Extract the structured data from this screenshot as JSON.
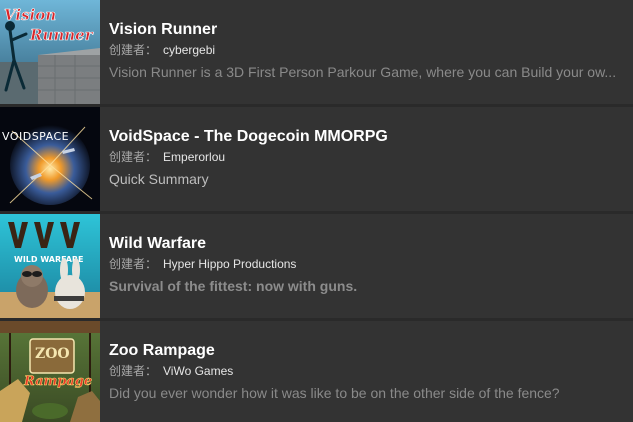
{
  "games": [
    {
      "title": "Vision Runner",
      "creator_label": "创建者：",
      "creator": "cybergebi",
      "description": "Vision Runner is a 3D First Person Parkour Game, where you can Build your ow...",
      "thumb_title": "Vision Runner"
    },
    {
      "title": "VoidSpace - The Dogecoin MMORPG",
      "creator_label": "创建者：",
      "creator": "Emperorlou",
      "description": "Quick Summary",
      "thumb_title": "VOIDSPACE"
    },
    {
      "title": "Wild Warfare",
      "creator_label": "创建者：",
      "creator": "Hyper Hippo Productions",
      "description": "Survival of the fittest: now with guns.",
      "thumb_title": "WILD WARFARE"
    },
    {
      "title": "Zoo Rampage",
      "creator_label": "创建者：",
      "creator": "ViWo Games",
      "description": "Did you ever wonder how it was like to be on the other side of the fence?",
      "thumb_title": "Zoo Rampage"
    }
  ]
}
